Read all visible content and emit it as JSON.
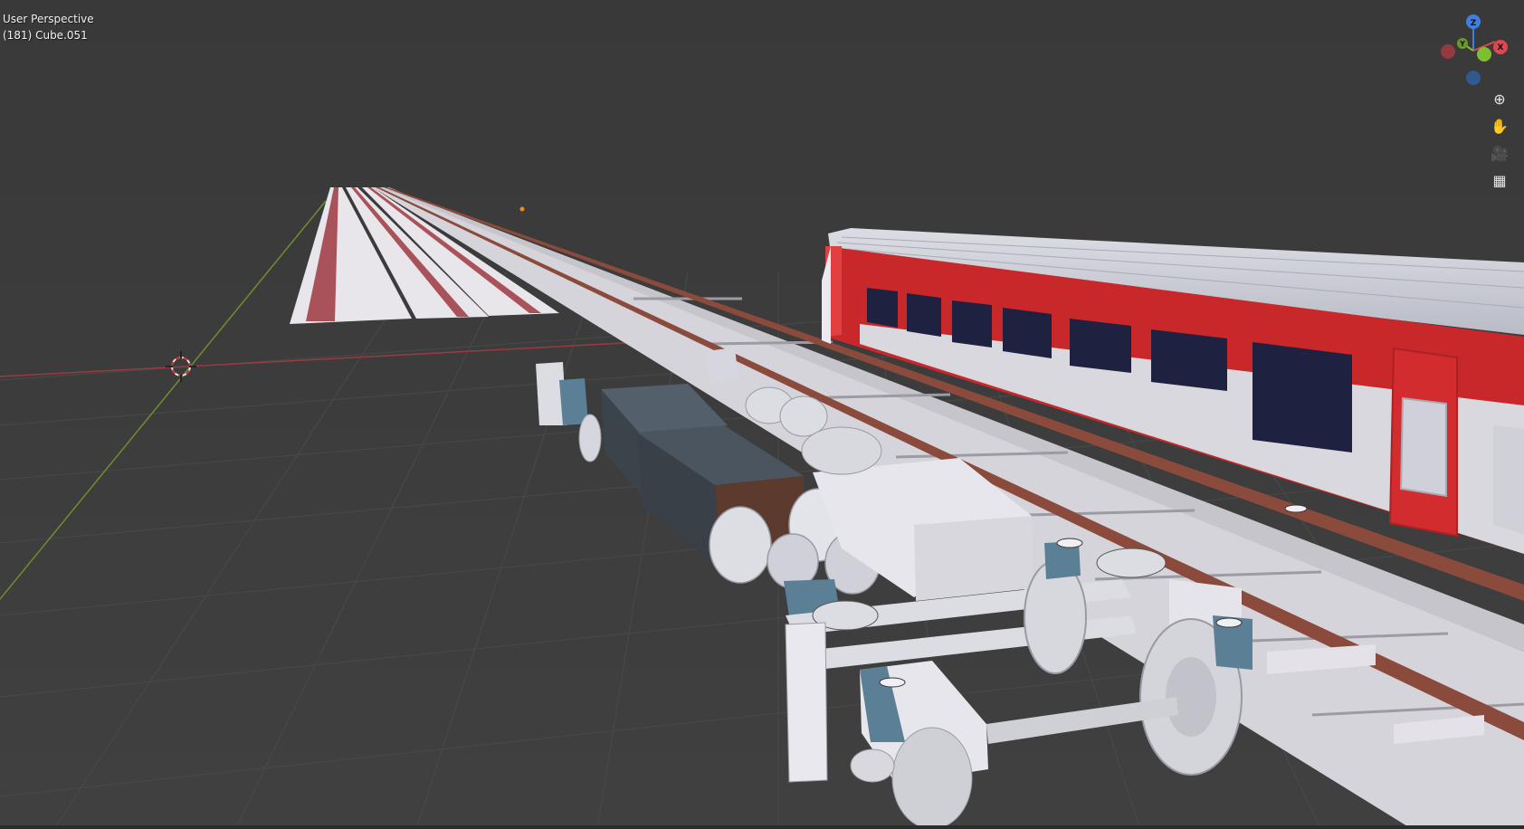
{
  "viewport": {
    "mode_label": "User Perspective",
    "object_label": "(181) Cube.051"
  },
  "gizmo": {
    "z_label": "Z",
    "y_label": "Y",
    "x_label": "X"
  },
  "nav_buttons": [
    {
      "icon": "zoom-icon",
      "glyph": "⊕"
    },
    {
      "icon": "hand-pan-icon",
      "glyph": "✋"
    },
    {
      "icon": "camera-icon",
      "glyph": "🎥"
    },
    {
      "icon": "grid-perspective-icon",
      "glyph": "▦"
    }
  ],
  "colors": {
    "background": "#3d3d3d",
    "train_red": "#c8282a",
    "window_navy": "#1e2240",
    "rail_brown": "#8a4a3c",
    "x_axis": "#e0464e",
    "y_axis": "#7cbf2f",
    "z_axis": "#3f7fe0"
  }
}
